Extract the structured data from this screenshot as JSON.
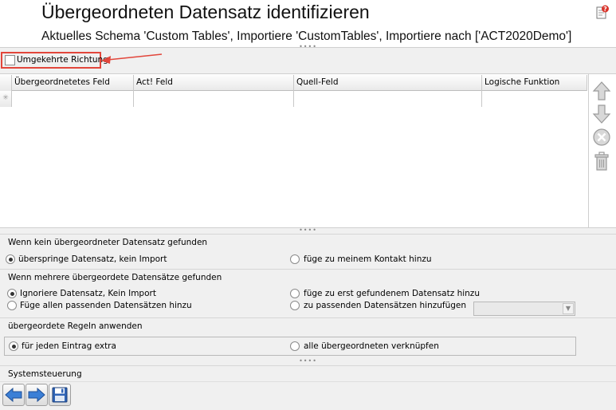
{
  "header": {
    "title": "Übergeordneten Datensatz identifizieren",
    "subtitle": "Aktuelles Schema 'Custom Tables', Importiere 'CustomTables', Importiere nach ['ACT2020Demo']"
  },
  "reverse": {
    "label": "Umgekehrte Richtung",
    "checked": false
  },
  "grid": {
    "columns": [
      "Übergeordnetetes Feld",
      "Act! Feld",
      "Quell-Feld",
      "Logische Funktion"
    ],
    "new_row_marker": "✳"
  },
  "no_parent": {
    "heading": "Wenn kein übergeordneter Datensatz gefunden",
    "options": [
      {
        "label": "überspringe Datensatz, kein Import",
        "selected": true
      },
      {
        "label": "füge zu meinem Kontakt hinzu",
        "selected": false
      }
    ]
  },
  "multiple_parents": {
    "heading": "Wenn mehrere übergeordete Datensätze gefunden",
    "options": [
      {
        "label": "Ignoriere Datensatz, Kein Import",
        "selected": true
      },
      {
        "label": "füge zu erst gefundenem Datensatz hinzu",
        "selected": false
      },
      {
        "label": "Füge allen passenden Datensätzen hinzu",
        "selected": false
      },
      {
        "label": "zu passenden Datensätzen hinzufügen",
        "selected": false
      }
    ],
    "select_value": ""
  },
  "rules": {
    "heading": "übergeordete Regeln anwenden",
    "options": [
      {
        "label": "für jeden Eintrag extra",
        "selected": true
      },
      {
        "label": "alle übergeordneten verknüpfen",
        "selected": false
      }
    ]
  },
  "system": {
    "heading": "Systemsteuerung"
  },
  "icons": {
    "help": "help-icon",
    "move_up": "arrow-up-icon",
    "move_down": "arrow-down-icon",
    "remove": "remove-icon",
    "delete": "trash-icon",
    "back": "arrow-left-icon",
    "forward": "arrow-right-icon",
    "save": "save-icon"
  },
  "colors": {
    "highlight": "#e2463b",
    "nav_blue": "#3b7fd6"
  }
}
